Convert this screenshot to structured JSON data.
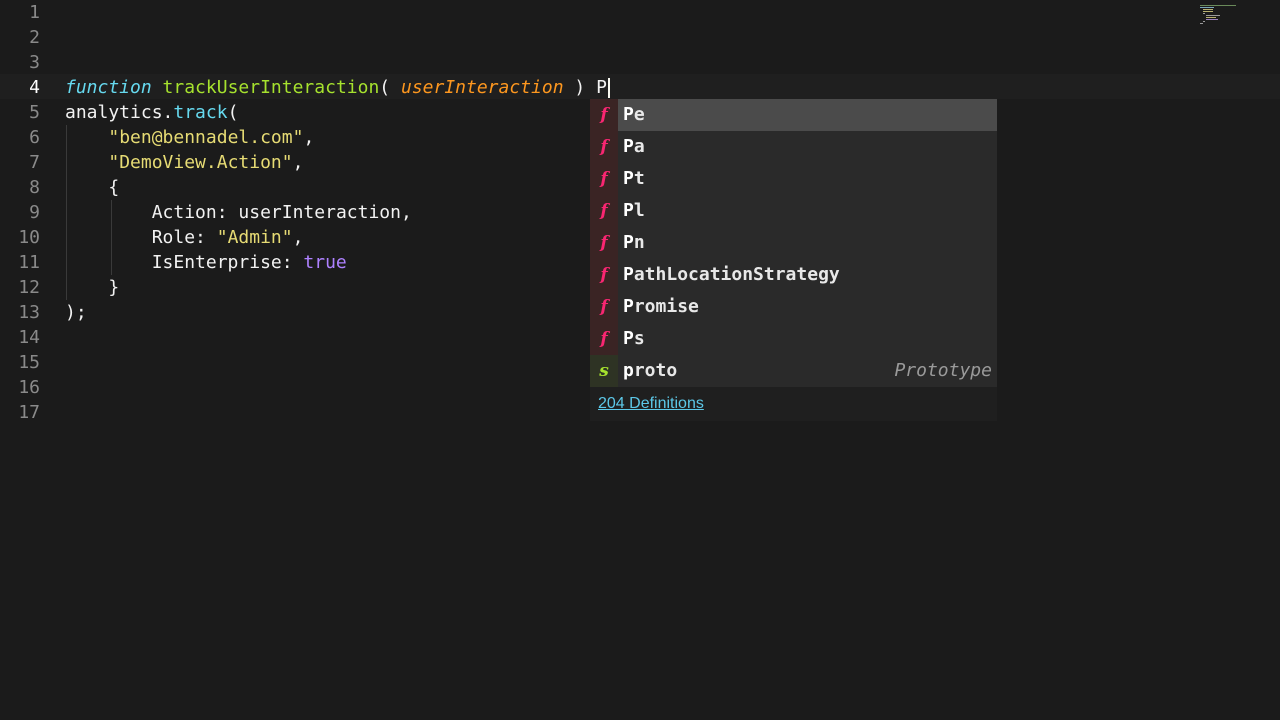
{
  "gutter": {
    "line_numbers": [
      "1",
      "2",
      "3",
      "4",
      "5",
      "6",
      "7",
      "8",
      "9",
      "10",
      "11",
      "12",
      "13",
      "14",
      "15",
      "16",
      "17"
    ],
    "active_line": "4"
  },
  "code": {
    "line4": {
      "keyword": "function",
      "name": "trackUserInteraction",
      "open": "( ",
      "param": "userInteraction",
      "close": " ) ",
      "typed": "P"
    },
    "line5": {
      "obj": "analytics.",
      "method": "track",
      "paren": "("
    },
    "line6": {
      "str": "\"ben@bennadel.com\"",
      "rest": ","
    },
    "line7": {
      "str": "\"DemoView.Action\"",
      "rest": ","
    },
    "line8": {
      "text": "{"
    },
    "line9": {
      "key": "Action: ",
      "val": "userInteraction,"
    },
    "line10": {
      "key": "Role: ",
      "str": "\"Admin\"",
      "rest": ","
    },
    "line11": {
      "key": "IsEnterprise: ",
      "bool": "true"
    },
    "line12": {
      "text": "}"
    },
    "line13": {
      "text": ");"
    }
  },
  "completion": {
    "items": [
      {
        "kind": "f",
        "match": "P",
        "rest": "e",
        "hint": ""
      },
      {
        "kind": "f",
        "match": "P",
        "rest": "a",
        "hint": ""
      },
      {
        "kind": "f",
        "match": "P",
        "rest": "t",
        "hint": ""
      },
      {
        "kind": "f",
        "match": "P",
        "rest": "l",
        "hint": ""
      },
      {
        "kind": "f",
        "match": "P",
        "rest": "n",
        "hint": ""
      },
      {
        "kind": "f",
        "match": "P",
        "rest": "athLocationStrategy",
        "hint": ""
      },
      {
        "kind": "f",
        "match": "P",
        "rest": "romise",
        "hint": ""
      },
      {
        "kind": "f",
        "match": "P",
        "rest": "s",
        "hint": ""
      },
      {
        "kind": "s",
        "match": "p",
        "rest": "roto",
        "hint": "Prototype"
      }
    ],
    "footer_link": "204 Definitions"
  },
  "colors": {
    "background": "#1b1b1b",
    "keyword": "#66d9ef",
    "function_name": "#a6e22e",
    "parameter": "#fd971f",
    "string": "#e6db74",
    "boolean": "#ae81ff",
    "kind_function": "#f92672",
    "kind_snippet": "#a6e22e",
    "link": "#5cc8e8"
  }
}
